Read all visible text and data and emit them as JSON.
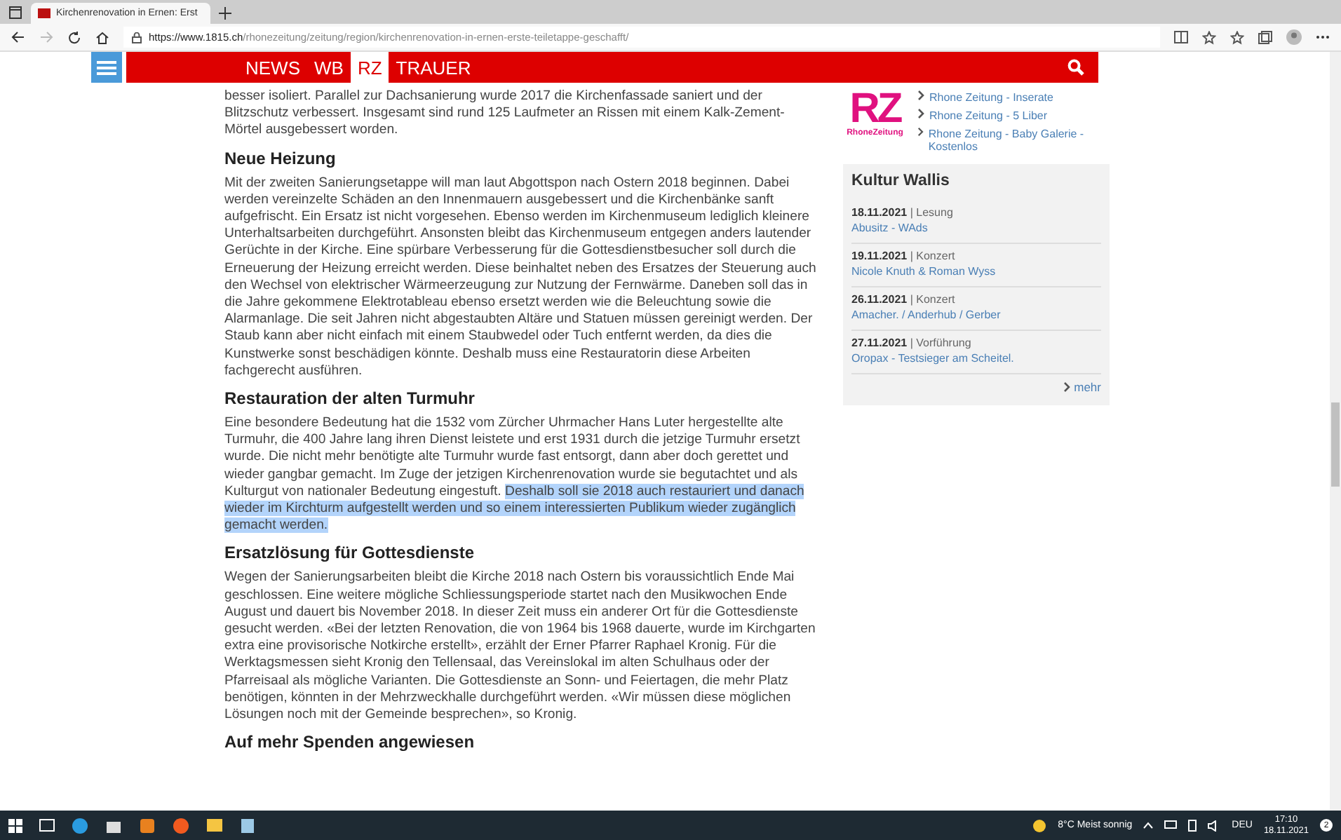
{
  "browser": {
    "tab_title": "Kirchenrenovation in Ernen: Erst",
    "url_host": "https://www.1815.ch",
    "url_path": "/rhonezeitung/zeitung/region/kirchenrenovation-in-ernen-erste-teiletappe-geschafft/"
  },
  "nav": {
    "items": [
      {
        "label": "NEWS",
        "selected": false
      },
      {
        "label": "WB",
        "selected": false
      },
      {
        "label": "RZ",
        "selected": true
      },
      {
        "label": "TRAUER",
        "selected": false
      }
    ]
  },
  "article": [
    {
      "kind": "paragraph",
      "segments": [
        {
          "text": "besser isoliert. Parallel zur Dachsanierung wurde 2017 die Kirchenfassade saniert und der Blitzschutz verbessert. Insgesamt sind rund 125 Laufmeter an Rissen mit einem Kalk-Zement-Mörtel ausgebessert worden.",
          "highlighted": false
        }
      ]
    },
    {
      "kind": "heading",
      "text": "Neue Heizung"
    },
    {
      "kind": "paragraph",
      "segments": [
        {
          "text": "Mit der zweiten Sanierungsetappe will man laut Abgottspon nach Ostern 2018 beginnen. Dabei werden vereinzelte Schäden an den Innenmauern ausgebessert und die Kirchenbänke sanft aufgefrischt. Ein Ersatz ist nicht vorgesehen. Ebenso werden im Kirchenmuseum lediglich kleinere Unterhaltsarbeiten durchgeführt. Ansonsten bleibt das Kirchenmuseum entgegen anders lautender Gerüchte in der Kirche. Eine spürbare Verbesserung für die Gottesdienstbesucher soll durch die Erneuerung der Heizung erreicht werden. Diese beinhaltet neben des Ersatzes der Steuerung auch den Wechsel von elektrischer Wärmeerzeugung zur Nutzung der Fernwärme. Daneben soll das in die Jahre gekommene Elektrotableau ebenso ersetzt werden wie die Beleuchtung sowie die Alarmanlage. Die seit Jahren nicht abgestaubten Altäre und Statuen müssen gereinigt werden. Der Staub kann aber nicht einfach mit einem Staubwedel oder Tuch entfernt werden, da dies die Kunstwerke sonst beschädigen könnte. Deshalb muss eine Restauratorin diese Arbeiten fachgerecht ausführen.",
          "highlighted": false
        }
      ]
    },
    {
      "kind": "heading",
      "text": "Restauration der alten Turmuhr"
    },
    {
      "kind": "paragraph",
      "segments": [
        {
          "text": "Eine besondere Bedeutung hat die 1532 vom Zürcher Uhrmacher Hans Luter hergestellte alte Turmuhr, die 400 Jahre lang ihren Dienst leistete und erst 1931 durch die jetzige Turmuhr ersetzt wurde. Die nicht mehr benötigte alte Turmuhr wurde fast entsorgt, dann aber doch gerettet und wieder gangbar gemacht. Im Zuge der jetzigen Kirchenrenovation wurde sie begutachtet und als Kulturgut von nationaler Bedeutung eingestuft. ",
          "highlighted": false
        },
        {
          "text": "Deshalb soll sie 2018 auch restauriert und danach wieder im Kirchturm aufgestellt werden und so einem interessierten Publikum wieder zugänglich gemacht werden.",
          "highlighted": true
        }
      ]
    },
    {
      "kind": "heading",
      "text": "Ersatzlösung für Gottesdienste"
    },
    {
      "kind": "paragraph",
      "segments": [
        {
          "text": "Wegen der Sanierungsarbeiten bleibt die Kirche 2018 nach Ostern bis voraussichtlich Ende Mai geschlossen. Eine weitere mögliche Schliessungsperiode startet nach den Musikwochen Ende August und dauert bis November 2018. In dieser Zeit muss ein anderer Ort für die Gottesdienste gesucht werden. «Bei der letzten Renovation, die von 1964 bis 1968 dauerte, wurde im Kirchgarten extra eine provisorische Notkirche erstellt», erzählt der Erner Pfarrer Raphael Kronig. Für die Werktagsmessen sieht Kronig den Tellensaal, das Vereinslokal im alten Schulhaus oder der Pfarreisaal als mögliche Varianten. Die Gottesdienste an Sonn- und Feiertagen, die mehr Platz benötigen, könnten in der Mehrzweckhalle durchgeführt werden. «Wir müssen diese möglichen Lösungen noch mit der Gemeinde besprechen», so Kronig.",
          "highlighted": false
        }
      ]
    },
    {
      "kind": "heading",
      "text": "Auf mehr Spenden angewiesen"
    }
  ],
  "sidebar": {
    "logo": {
      "letters": "RZ",
      "name": "RhoneZeitung"
    },
    "links": [
      "Rhone Zeitung - Inserate",
      "Rhone Zeitung - 5 Liber",
      "Rhone Zeitung - Baby Galerie - Kostenlos"
    ],
    "kultur": {
      "title": "Kultur Wallis",
      "events": [
        {
          "date": "18.11.2021",
          "type": "| Lesung",
          "title": "Abusitz - WAds"
        },
        {
          "date": "19.11.2021",
          "type": "| Konzert",
          "title": "Nicole Knuth & Roman Wyss"
        },
        {
          "date": "26.11.2021",
          "type": "| Konzert",
          "title": "Amacher. / Anderhub / Gerber"
        },
        {
          "date": "27.11.2021",
          "type": "| Vorführung",
          "title": "Oropax - Testsieger am Scheitel."
        }
      ],
      "more": "mehr"
    }
  },
  "taskbar": {
    "weather": "8°C Meist sonnig",
    "language": "DEU",
    "time": "17:10",
    "date": "18.11.2021",
    "notifications": "2"
  }
}
